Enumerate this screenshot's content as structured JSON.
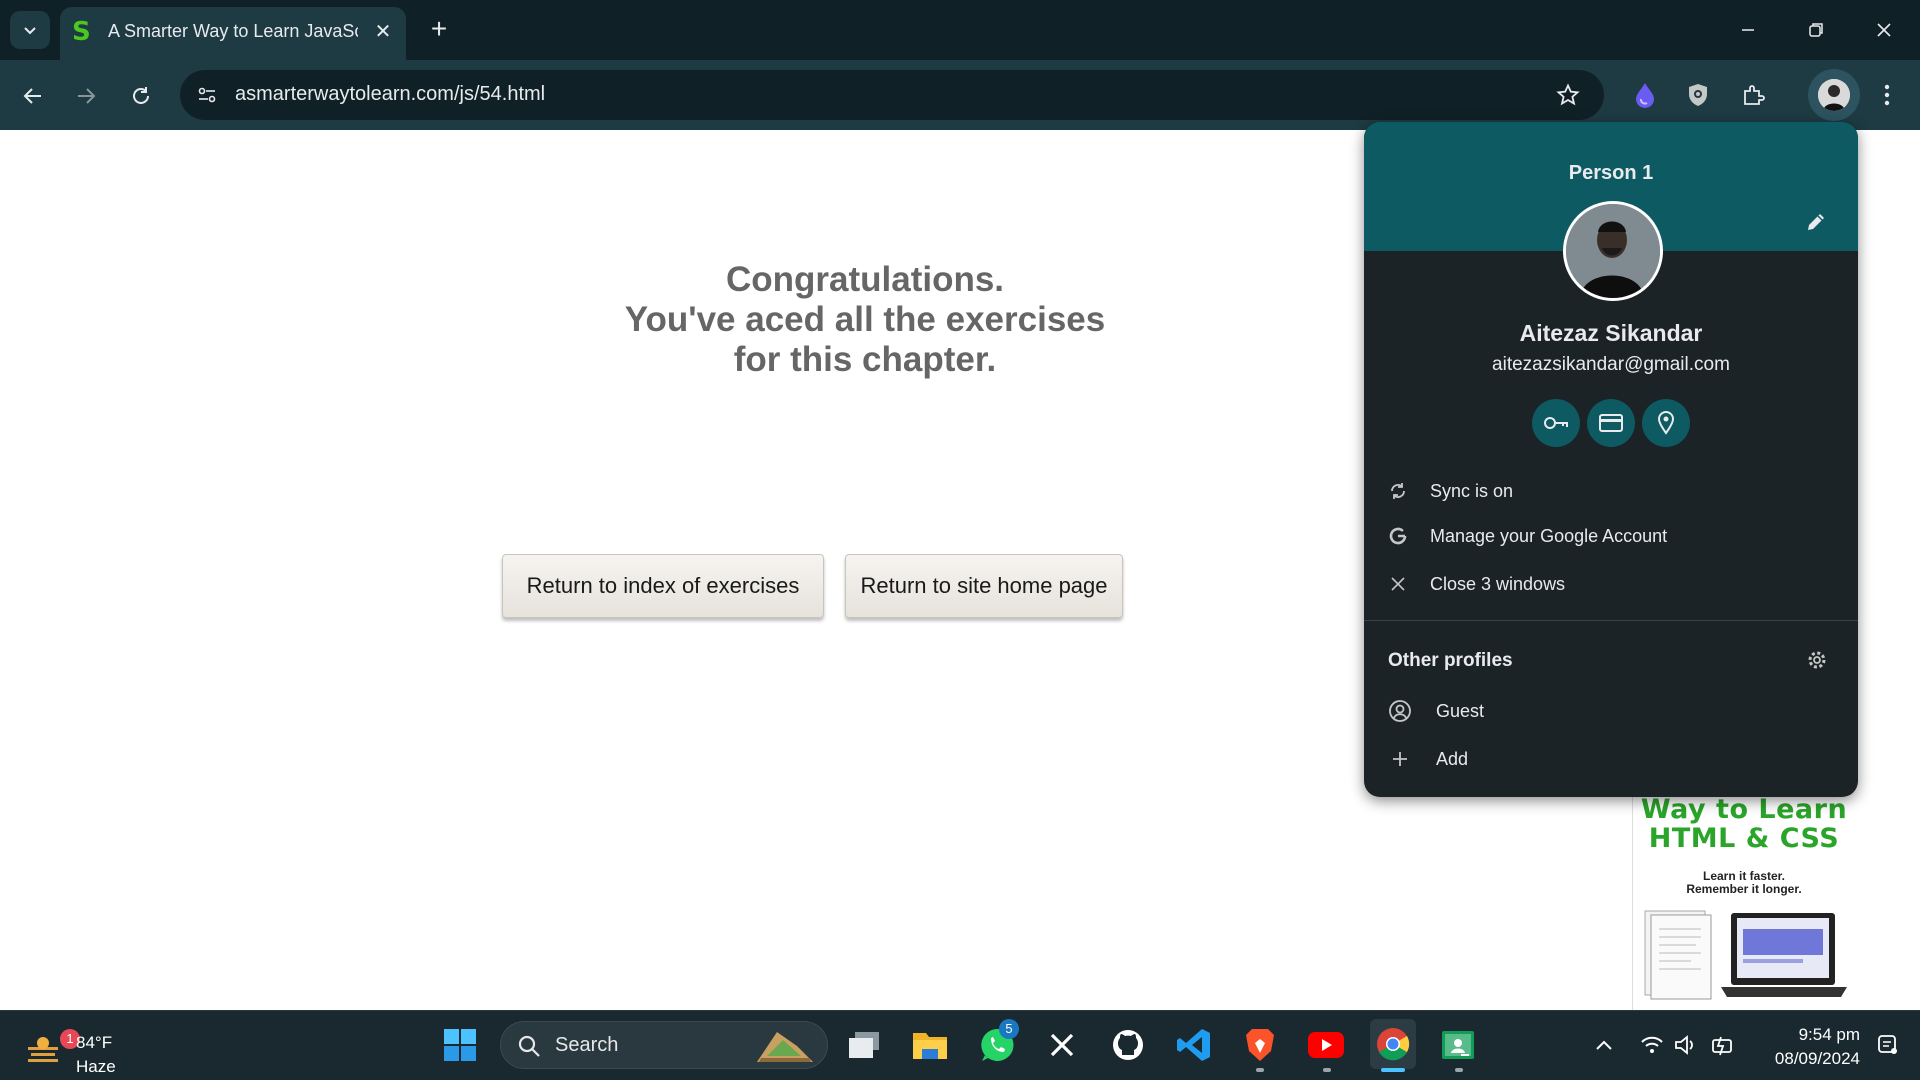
{
  "browser": {
    "tab_title": "A Smarter Way to Learn JavaScript",
    "tab_favicon": "S",
    "new_tab_label": "+",
    "close_tab_label": "✕",
    "url": "asmarterwaytolearn.com/js/54.html"
  },
  "page": {
    "congrats_line1": "Congratulations.",
    "congrats_line2": "You've aced all the exercises",
    "congrats_line3": "for this chapter.",
    "btn_index": "Return to index of exercises",
    "btn_home": "Return to site home page",
    "ad_title_line1": "Way to Learn",
    "ad_title_line2": "HTML & CSS",
    "ad_sub_line1": "Learn it faster.",
    "ad_sub_line2": "Remember it longer."
  },
  "profile_menu": {
    "person_label": "Person 1",
    "name": "Aitezaz Sikandar",
    "email": "aitezazsikandar@gmail.com",
    "quick_actions": [
      "key-icon",
      "card-icon",
      "location-icon"
    ],
    "items": [
      {
        "icon": "sync-icon",
        "label": "Sync is on"
      },
      {
        "icon": "google-icon",
        "label": "Manage your Google Account"
      },
      {
        "icon": "close-icon",
        "label": "Close 3 windows"
      }
    ],
    "other_profiles_label": "Other profiles",
    "other_profiles": [
      {
        "icon": "guest-icon",
        "label": "Guest"
      },
      {
        "icon": "plus-icon",
        "label": "Add"
      }
    ],
    "accent_color": "#0d5a62"
  },
  "taskbar": {
    "weather_temp": "84°F",
    "weather_condition": "Haze",
    "weather_badge": "1",
    "search_label": "Search",
    "whatsapp_badge": "5",
    "time": "9:54 pm",
    "date": "08/09/2024"
  }
}
